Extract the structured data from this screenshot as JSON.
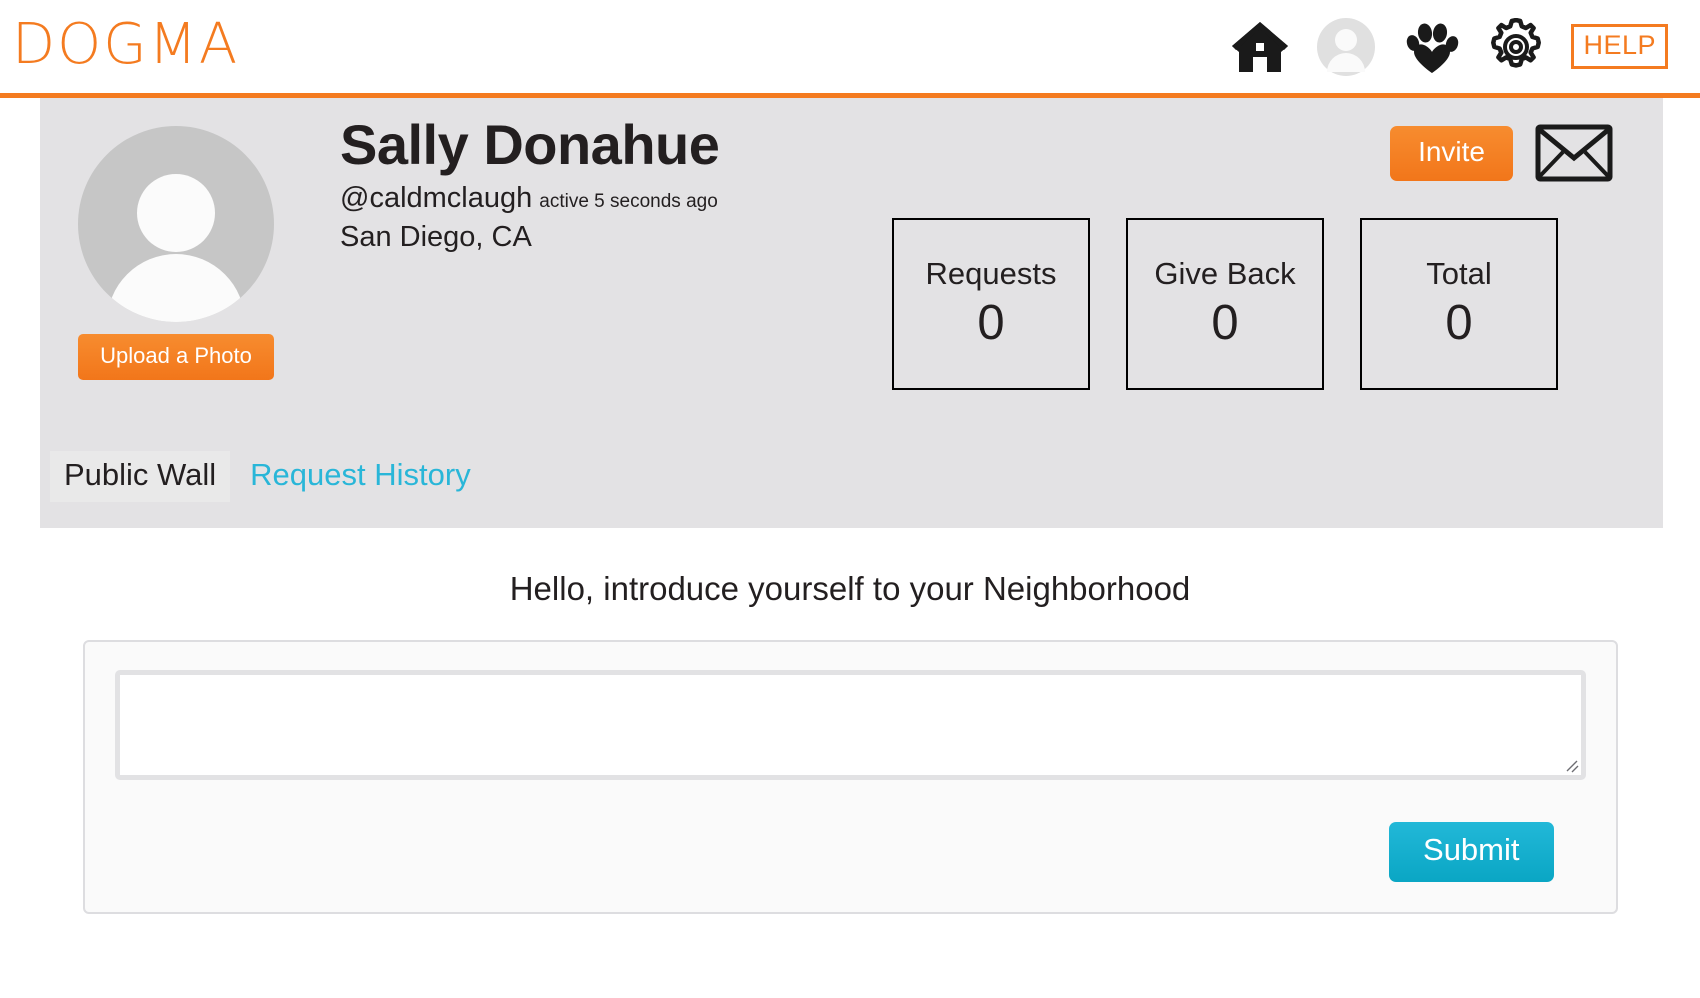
{
  "header": {
    "brand": "DOGMA",
    "icons": [
      {
        "name": "home-icon",
        "label": "Home"
      },
      {
        "name": "profile-avatar-icon",
        "label": "Profile"
      },
      {
        "name": "paw-heart-icon",
        "label": "Pets"
      },
      {
        "name": "gear-icon",
        "label": "Settings"
      }
    ],
    "help_label": "HELP",
    "accent_color": "#f47b20"
  },
  "profile": {
    "avatar_alt": "Default user avatar",
    "upload_label": "Upload a Photo",
    "display_name": "Sally Donahue",
    "handle": "@caldmclaugh",
    "active_status": "active 5 seconds ago",
    "location": "San Diego, CA",
    "invite_label": "Invite",
    "message_icon": "envelope-icon",
    "stats": [
      {
        "label": "Requests",
        "value": "0"
      },
      {
        "label": "Give Back",
        "value": "0"
      },
      {
        "label": "Total",
        "value": "0"
      }
    ],
    "tabs": [
      {
        "label": "Public Wall",
        "active": true
      },
      {
        "label": "Request History",
        "active": false
      }
    ]
  },
  "wall": {
    "heading": "Hello, introduce yourself to your Neighborhood",
    "compose_value": "",
    "compose_placeholder": "",
    "submit_label": "Submit",
    "submit_color": "#0aa6c4",
    "link_color": "#29b6d8"
  }
}
